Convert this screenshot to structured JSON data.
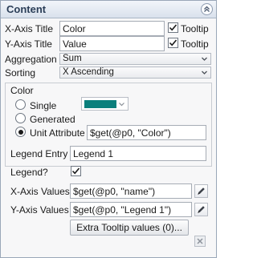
{
  "panel": {
    "title": "Content"
  },
  "fields": {
    "x_axis_title": {
      "label": "X-Axis Title",
      "value": "Color",
      "tooltip_label": "Tooltip",
      "tooltip_checked": true
    },
    "y_axis_title": {
      "label": "Y-Axis Title",
      "value": "Value",
      "tooltip_label": "Tooltip",
      "tooltip_checked": true
    },
    "aggregation": {
      "label": "Aggregation",
      "selected": "Sum"
    },
    "sorting": {
      "label": "Sorting",
      "selected": "X Ascending"
    }
  },
  "color": {
    "section_label": "Color",
    "options": [
      {
        "label": "Single",
        "selected": false
      },
      {
        "label": "Generated",
        "selected": false
      },
      {
        "label": "Unit Attribute",
        "selected": true
      }
    ],
    "swatch_color": "#0a7f7c",
    "unit_attribute_value": "$get(@p0, \"Color\")",
    "legend_entry_label": "Legend Entry",
    "legend_entry_value": "Legend 1",
    "legend_label": "Legend?",
    "legend_checked": true
  },
  "values": {
    "x_axis_values_label": "X-Axis Values",
    "x_axis_values": "$get(@p0, \"name\")",
    "y_axis_values_label": "Y-Axis Values",
    "y_axis_values": "$get(@p0, \"Legend 1\")"
  },
  "buttons": {
    "extra_tooltip": "Extra Tooltip values (0)..."
  },
  "icons": [
    "chevron-up-icon",
    "chevron-down-icon",
    "checkmark-icon",
    "pencil-icon",
    "close-icon"
  ]
}
